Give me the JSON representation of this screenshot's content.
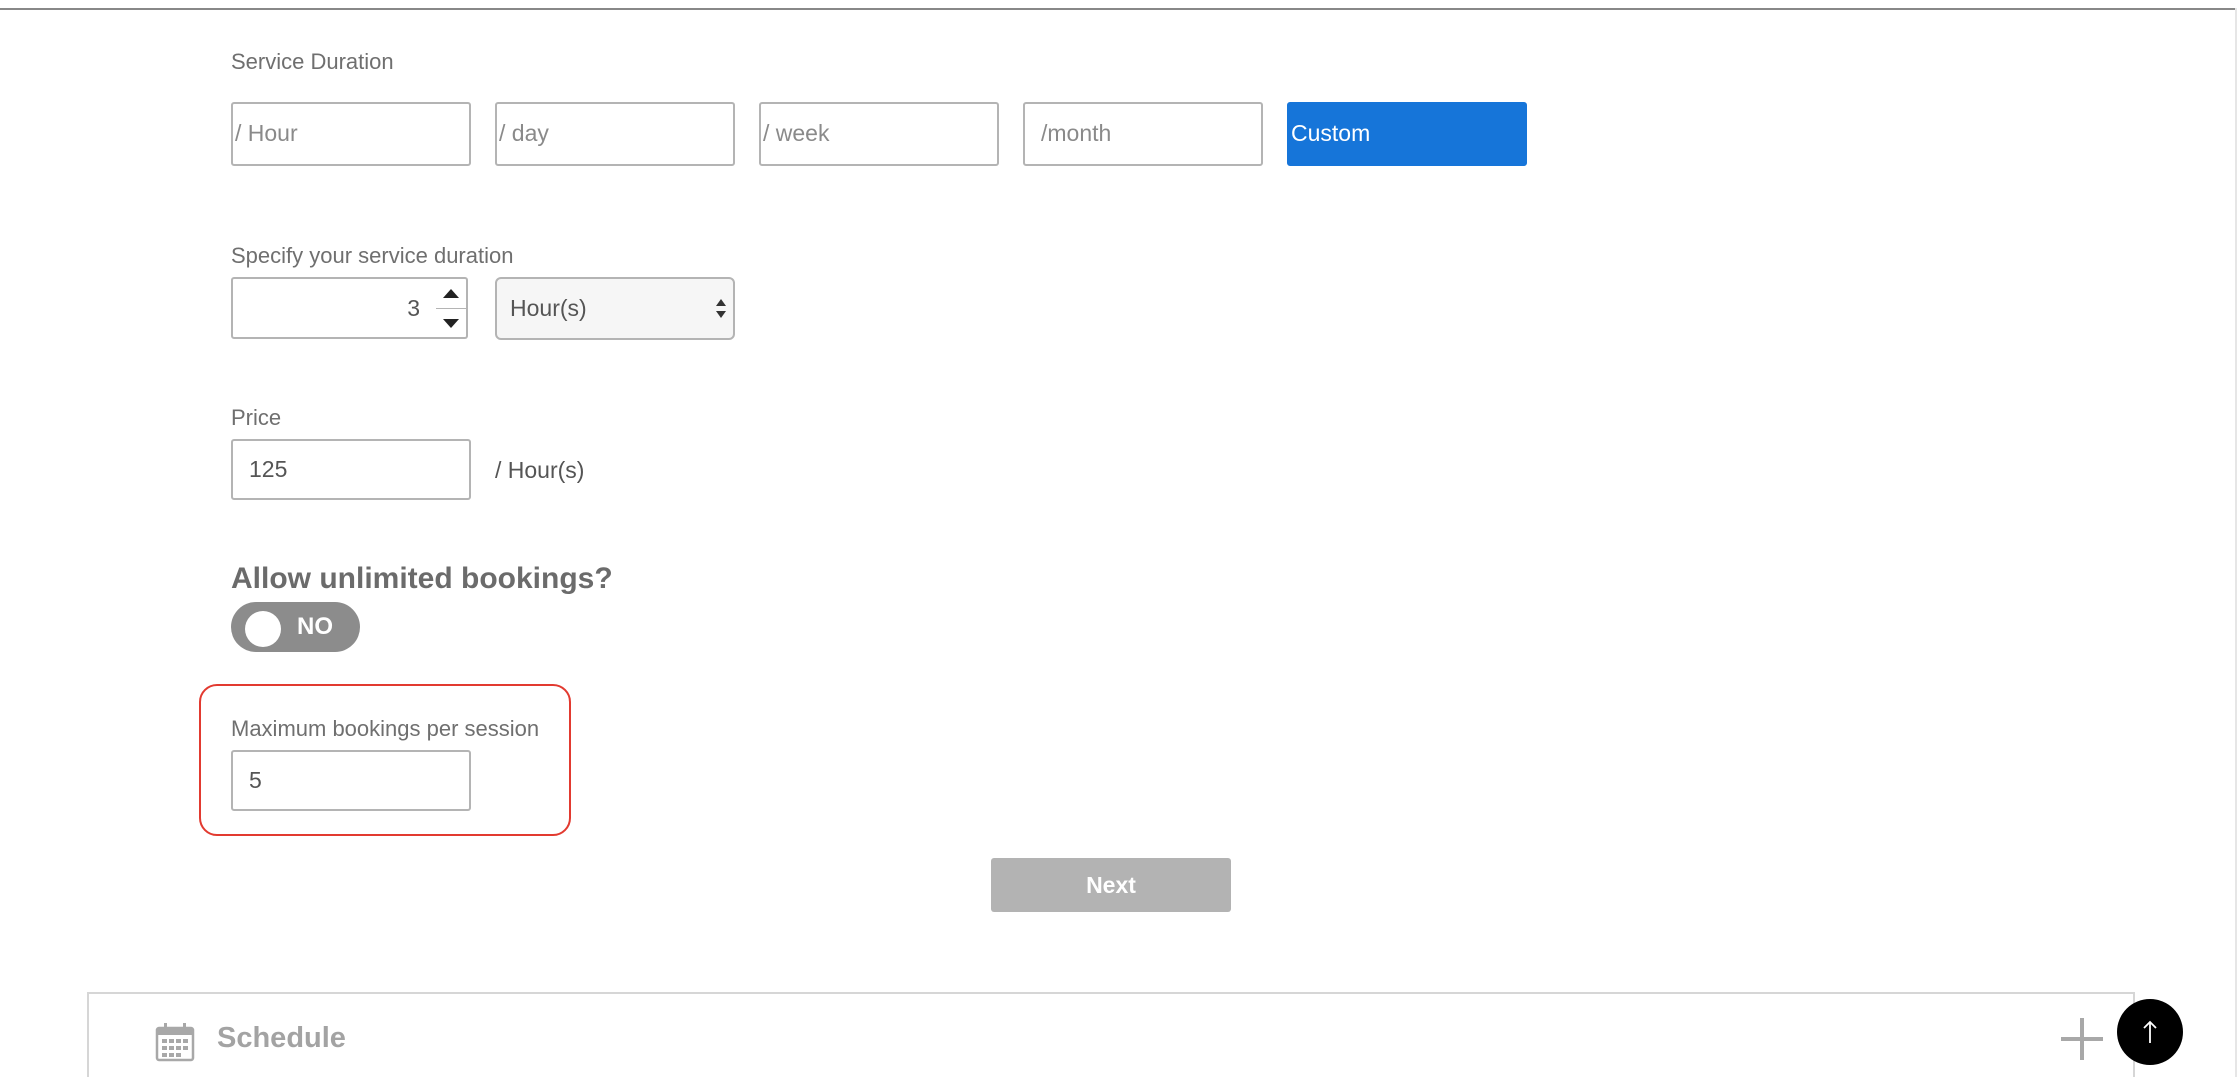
{
  "service_duration": {
    "label": "Service Duration",
    "options": [
      {
        "label": "/ Hour"
      },
      {
        "label": "/ day"
      },
      {
        "label": "/ week"
      },
      {
        "label": "/month"
      },
      {
        "label": "Custom"
      }
    ],
    "selected": "Custom"
  },
  "specify_duration": {
    "label": "Specify your service duration",
    "value": "3",
    "unit_selected": "Hour(s)"
  },
  "price": {
    "label": "Price",
    "value": "125",
    "unit": "/  Hour(s)"
  },
  "unlimited_bookings": {
    "heading": "Allow unlimited bookings?",
    "toggle_label": "NO",
    "enabled": false
  },
  "max_bookings": {
    "label": "Maximum bookings per session",
    "value": "5"
  },
  "next_button": {
    "label": "Next"
  },
  "schedule": {
    "title": "Schedule"
  },
  "colors": {
    "accent": "#1675d9",
    "highlight": "#e23a30",
    "toggle_off": "#8c8c8c",
    "button_disabled": "#b3b3b3"
  },
  "icons": {
    "calendar": "calendar-icon",
    "expand": "plus-icon",
    "scroll_top": "arrow-up-icon"
  }
}
